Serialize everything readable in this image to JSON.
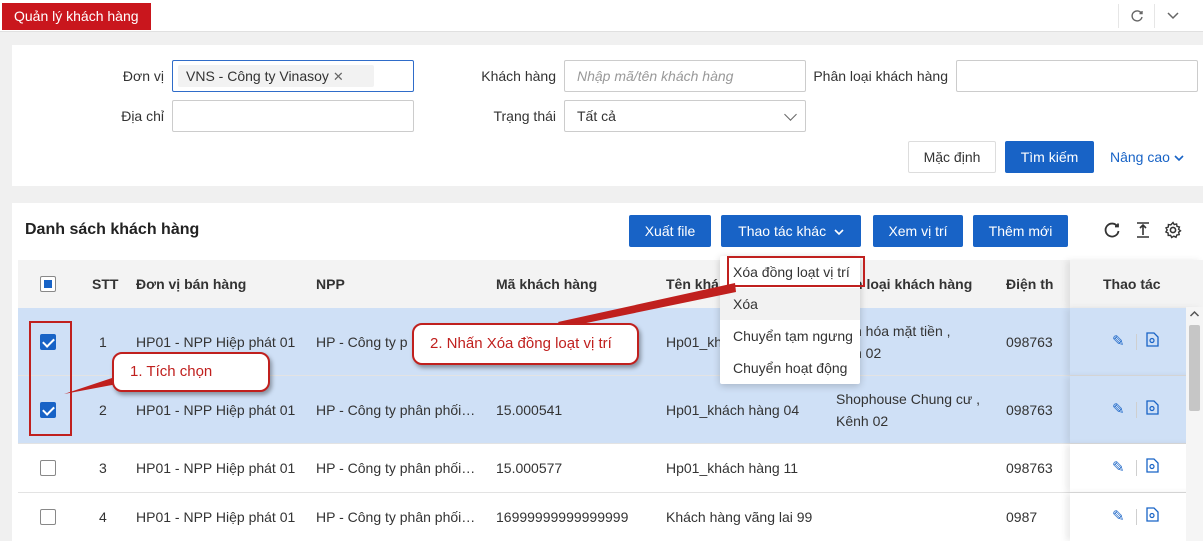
{
  "tabs": {
    "active": "Quản lý khách hàng"
  },
  "filters": {
    "don_vi_label": "Đơn vị",
    "don_vi_chip": "VNS - Công ty Vinasoy",
    "khach_hang_label": "Khách hàng",
    "khach_hang_placeholder": "Nhập mã/tên khách hàng",
    "phan_loai_label": "Phân loại khách hàng",
    "dia_chi_label": "Địa chỉ",
    "trang_thai_label": "Trạng thái",
    "trang_thai_value": "Tất cả",
    "btn_default": "Mặc định",
    "btn_search": "Tìm kiếm",
    "advanced": "Nâng cao"
  },
  "list": {
    "title": "Danh sách khách hàng",
    "btn_export": "Xuất file",
    "btn_other": "Thao tác khác",
    "btn_view_location": "Xem vị trí",
    "btn_add": "Thêm mới",
    "columns": [
      "STT",
      "Đơn vị bán hàng",
      "NPP",
      "Mã khách hàng",
      "Tên khá",
      "n loại khách hàng",
      "Điện th",
      "Thao tác"
    ],
    "rows": [
      {
        "stt": "1",
        "don_vi": "HP01 - NPP Hiệp phát 01",
        "npp": "HP - Công ty p",
        "ma": "",
        "ten": "Hp01_kh",
        "phan_loai_1": "h hóa mặt tiền ,",
        "phan_loai_2": "h 02",
        "dien_thoai": "098763",
        "checked": true
      },
      {
        "stt": "2",
        "don_vi": "HP01 - NPP Hiệp phát 01",
        "npp": "HP - Công ty phân phối…",
        "ma": "15.000541",
        "ten": "Hp01_khách hàng 04",
        "phan_loai_1": "Shophouse Chung cư ,",
        "phan_loai_2": "Kênh 02",
        "dien_thoai": "098763",
        "checked": true
      },
      {
        "stt": "3",
        "don_vi": "HP01 - NPP Hiệp phát 01",
        "npp": "HP - Công ty phân phối…",
        "ma": "15.000577",
        "ten": "Hp01_khách hàng 11",
        "phan_loai_1": "",
        "phan_loai_2": "",
        "dien_thoai": "098763",
        "checked": false
      },
      {
        "stt": "4",
        "don_vi": "HP01 - NPP Hiệp phát 01",
        "npp": "HP - Công ty phân phối…",
        "ma": "16999999999999999",
        "ten": "Khách hàng vãng lai 99",
        "phan_loai_1": "",
        "phan_loai_2": "",
        "dien_thoai": "0987",
        "checked": false
      }
    ]
  },
  "dropdown": {
    "items": [
      "Xóa đồng loạt vị trí",
      "Xóa",
      "Chuyển tạm ngưng",
      "Chuyển hoạt động"
    ]
  },
  "annotations": {
    "step1": "1. Tích chọn",
    "step2": "2. Nhấn Xóa đồng loạt vị trí"
  },
  "colors": {
    "brand_red": "#c9161d",
    "primary_blue": "#1863c6",
    "selected_row": "#cfe0f6",
    "annotation_red": "#c0201e"
  }
}
